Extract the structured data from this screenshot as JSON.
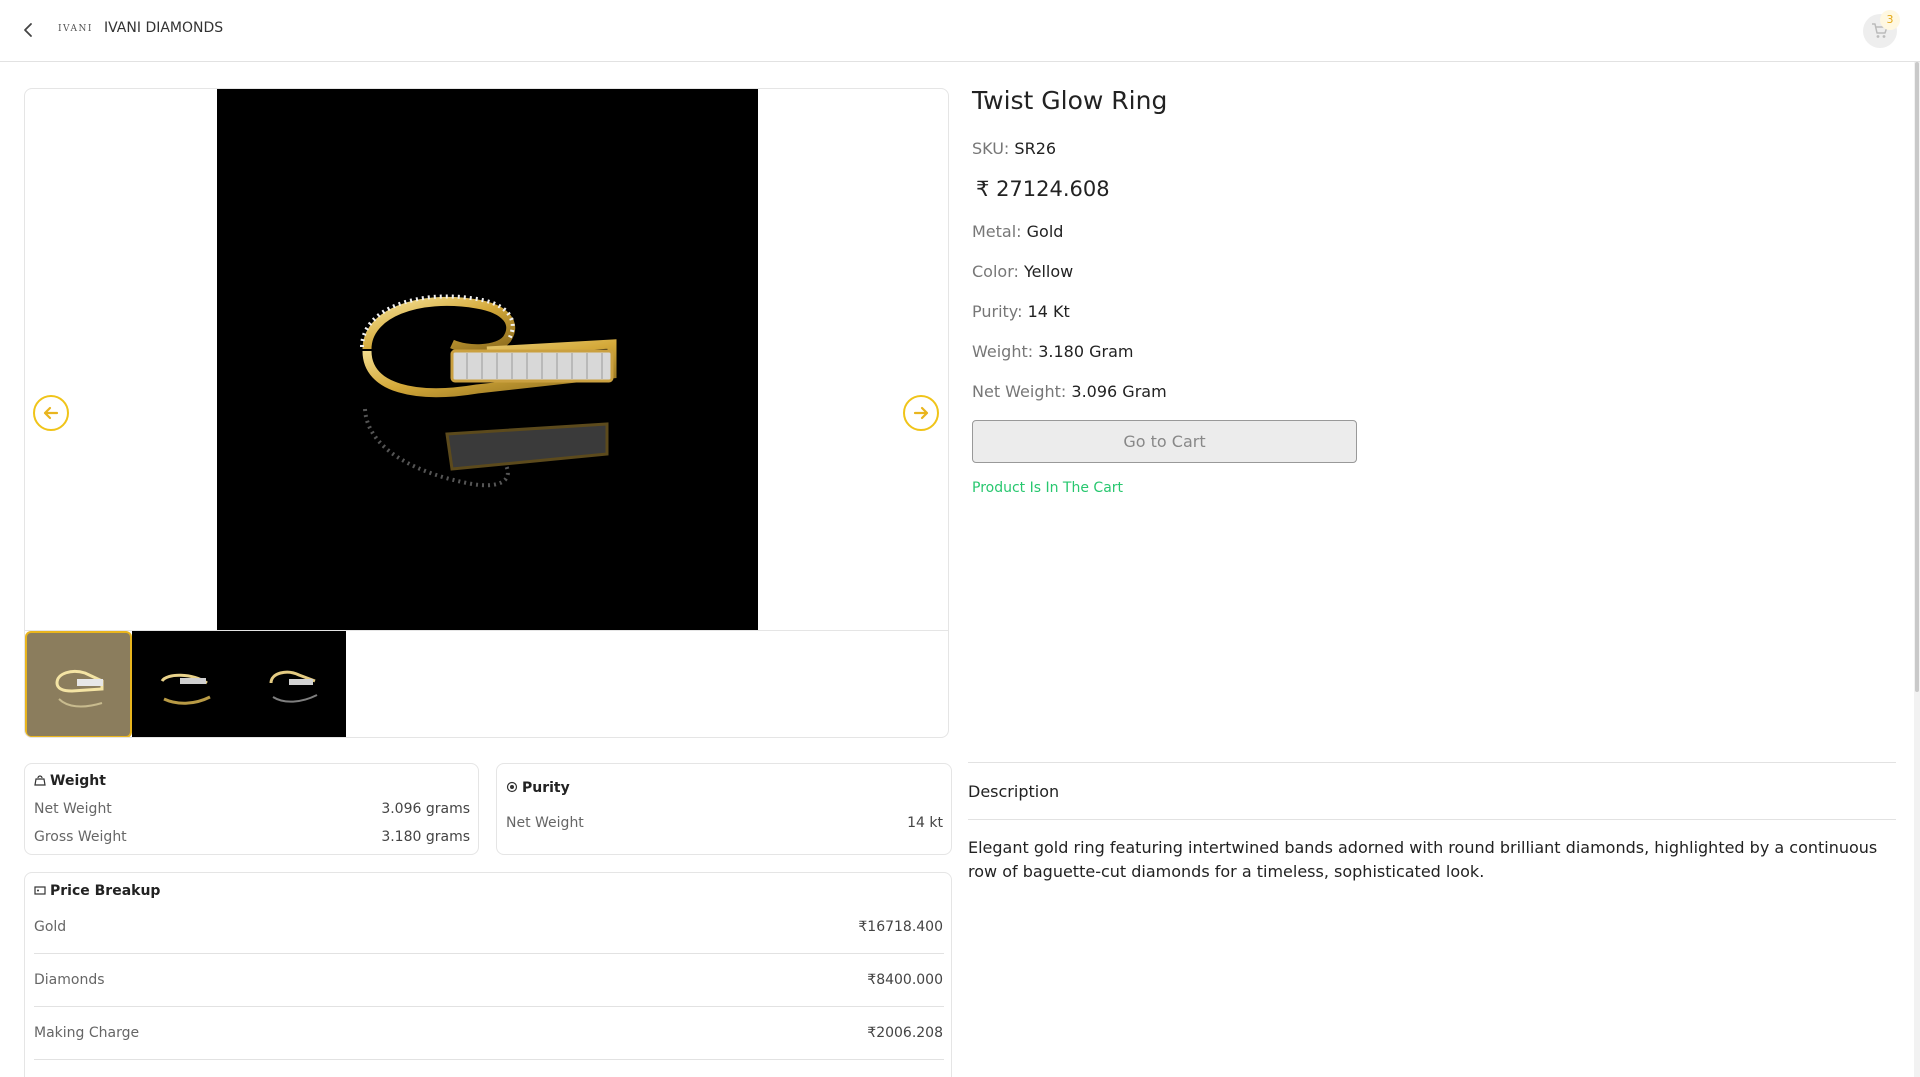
{
  "header": {
    "logo_text": "IVANI",
    "brand_name": "IVANI DIAMONDS",
    "cart_count": "3"
  },
  "product": {
    "title": "Twist Glow Ring",
    "sku_label": "SKU:",
    "sku": "SR26",
    "currency": "₹",
    "price": "27124.608",
    "attributes": [
      {
        "label": "Metal:",
        "value": "Gold"
      },
      {
        "label": "Color:",
        "value": "Yellow"
      },
      {
        "label": "Purity:",
        "value": "14 Kt"
      },
      {
        "label": "Weight:",
        "value": "3.180 Gram"
      },
      {
        "label": "Net Weight:",
        "value": "3.096 Gram"
      }
    ],
    "cart_button": "Go to Cart",
    "cart_status": "Product Is In The Cart"
  },
  "weight_card": {
    "title": "Weight",
    "rows": [
      {
        "label": "Net Weight",
        "value": "3.096 grams"
      },
      {
        "label": "Gross Weight",
        "value": "3.180 grams"
      }
    ]
  },
  "purity_card": {
    "title": "Purity",
    "rows": [
      {
        "label": "Net Weight",
        "value": "14 kt"
      }
    ]
  },
  "price_card": {
    "title": "Price Breakup",
    "rows": [
      {
        "label": "Gold",
        "currency": "₹",
        "value": "16718.400"
      },
      {
        "label": "Diamonds",
        "currency": "₹",
        "value": "8400.000"
      },
      {
        "label": "Making Charge",
        "currency": "₹",
        "value": "2006.208"
      }
    ]
  },
  "description": {
    "heading": "Description",
    "text": "Elegant gold ring featuring intertwined bands adorned with round brilliant diamonds, highlighted by a continuous row of baguette-cut diamonds for a timeless, sophisticated look."
  },
  "colors": {
    "accent": "#f0c419",
    "success": "#28c76f",
    "badge": "#e4a816"
  }
}
